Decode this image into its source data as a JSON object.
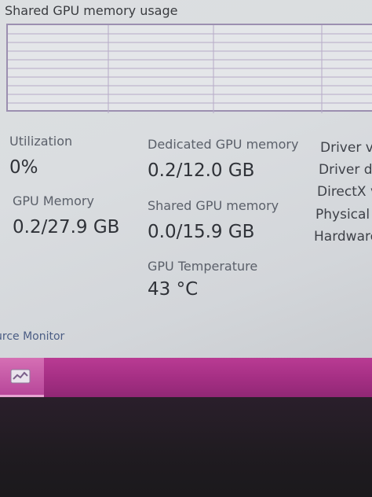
{
  "chart": {
    "title": "Shared GPU memory usage"
  },
  "stats": {
    "utilization": {
      "label": "Utilization",
      "value": "0%"
    },
    "gpu_memory": {
      "label": "GPU Memory",
      "value": "0.2/27.9 GB"
    },
    "dedicated": {
      "label": "Dedicated GPU memory",
      "value": "0.2/12.0 GB"
    },
    "shared": {
      "label": "Shared GPU memory",
      "value": "0.0/15.9 GB"
    },
    "temperature": {
      "label": "GPU Temperature",
      "value": "43 °C"
    }
  },
  "details": [
    "Driver v",
    "Driver d",
    "DirectX v",
    "Physical",
    "Hardware"
  ],
  "footer": {
    "resource_monitor": "urce Monitor"
  },
  "taskbar": {
    "app_icon": "task-manager-icon"
  },
  "colors": {
    "taskbar": "#a52f84",
    "chart_border": "#9c8fb0"
  }
}
